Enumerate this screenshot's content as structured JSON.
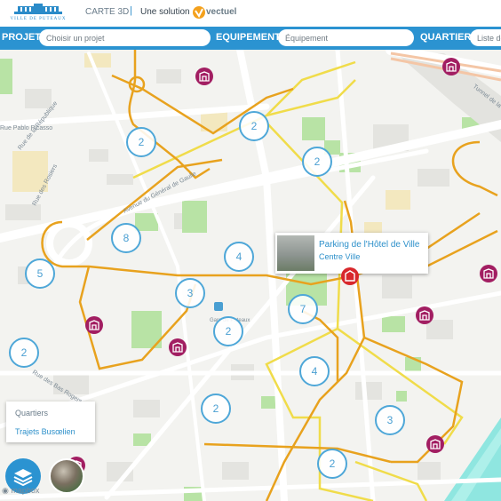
{
  "header": {
    "logo_caption": "VILLE DE PUTEAUX",
    "title": "CARTE 3D",
    "separator": "|",
    "solution_text": "Une solution",
    "vendor_name": "vectuel"
  },
  "filters": {
    "projet_label": "PROJET",
    "projet_placeholder": "Choisir un projet",
    "equipement_label": "EQUIPEMENT",
    "equipement_placeholder": "Équipement",
    "quartier_label": "QUARTIER",
    "quartier_placeholder": "Liste des quartiers"
  },
  "map": {
    "street_labels": [
      "Rue Pablo Picasso",
      "Rue des Rosiers",
      "Avenue du Général de Gaulle",
      "Rue des Bas Rogers",
      "Rue de la République",
      "Tunnel de la Défense",
      "Gare de Puteaux"
    ],
    "clusters": [
      {
        "id": "c1",
        "count": "2"
      },
      {
        "id": "c2",
        "count": "2"
      },
      {
        "id": "c3",
        "count": "2"
      },
      {
        "id": "c4",
        "count": "8"
      },
      {
        "id": "c5",
        "count": "4"
      },
      {
        "id": "c6",
        "count": "5"
      },
      {
        "id": "c7",
        "count": "3"
      },
      {
        "id": "c8",
        "count": "7"
      },
      {
        "id": "c9",
        "count": "2"
      },
      {
        "id": "c10",
        "count": "2"
      },
      {
        "id": "c11",
        "count": "4"
      },
      {
        "id": "c12",
        "count": "2"
      },
      {
        "id": "c13",
        "count": "3"
      },
      {
        "id": "c14",
        "count": "2"
      }
    ],
    "poi_icon": "building-icon",
    "colors": {
      "route": "#e8a21e",
      "quartier": "#f0dc4a",
      "cluster": "#4ea7d8",
      "poi": "#a21e62",
      "accent": "#2b93d1",
      "selected": "#d8282c"
    }
  },
  "popup": {
    "title": "Parking de l'Hôtel de Ville",
    "subtitle": "Centre Ville"
  },
  "legend": {
    "quartiers_label": "Quartiers",
    "trajets_label": "Trajets Busœlien"
  },
  "controls": {
    "layers_icon": "layers-icon"
  },
  "attribution": "mapbox"
}
